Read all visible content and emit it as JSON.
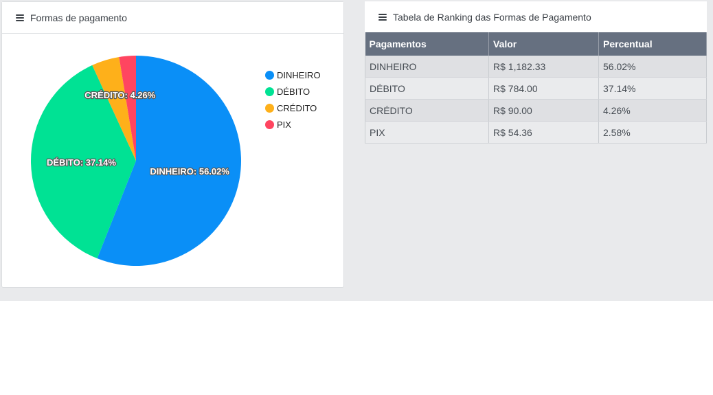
{
  "left_panel": {
    "title": "Formas de pagamento"
  },
  "right_panel": {
    "title": "Tabela de Ranking das Formas de Pagamento"
  },
  "table": {
    "headers": [
      "Pagamentos",
      "Valor",
      "Percentual"
    ],
    "rows": [
      [
        "DINHEIRO",
        "R$ 1,182.33",
        "56.02%"
      ],
      [
        "DÉBITO",
        "R$ 784.00",
        "37.14%"
      ],
      [
        "CRÉDITO",
        "R$ 90.00",
        "4.26%"
      ],
      [
        "PIX",
        "R$ 54.36",
        "2.58%"
      ]
    ]
  },
  "chart_data": {
    "type": "pie",
    "categories": [
      "DINHEIRO",
      "DÉBITO",
      "CRÉDITO",
      "PIX"
    ],
    "values": [
      56.02,
      37.14,
      4.26,
      2.58
    ],
    "labels": [
      "DINHEIRO: 56.02%",
      "DÉBITO: 37.14%",
      "CRÉDITO: 4.26%",
      ""
    ],
    "colors": [
      "#0a8ff7",
      "#00e294",
      "#feb01a",
      "#ff4560"
    ],
    "legend_position": "right"
  }
}
